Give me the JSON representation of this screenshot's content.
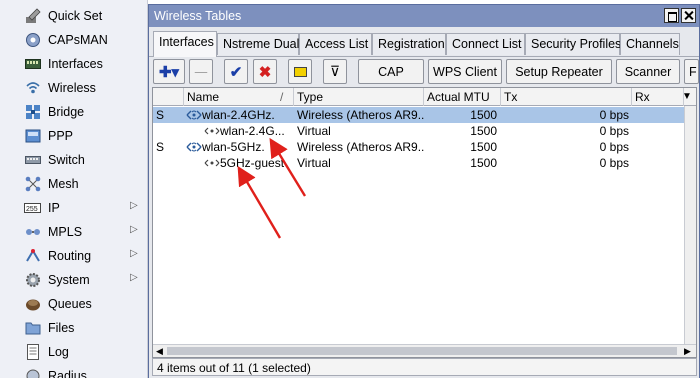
{
  "sidebar": {
    "items": [
      {
        "label": "Quick Set",
        "icon": "quick-set-icon",
        "has_submenu": false
      },
      {
        "label": "CAPsMAN",
        "icon": "capsman-icon",
        "has_submenu": false
      },
      {
        "label": "Interfaces",
        "icon": "interfaces-icon",
        "has_submenu": false
      },
      {
        "label": "Wireless",
        "icon": "wireless-icon",
        "has_submenu": false
      },
      {
        "label": "Bridge",
        "icon": "bridge-icon",
        "has_submenu": false
      },
      {
        "label": "PPP",
        "icon": "ppp-icon",
        "has_submenu": false
      },
      {
        "label": "Switch",
        "icon": "switch-icon",
        "has_submenu": false
      },
      {
        "label": "Mesh",
        "icon": "mesh-icon",
        "has_submenu": false
      },
      {
        "label": "IP",
        "icon": "ip-icon",
        "has_submenu": true
      },
      {
        "label": "MPLS",
        "icon": "mpls-icon",
        "has_submenu": true
      },
      {
        "label": "Routing",
        "icon": "routing-icon",
        "has_submenu": true
      },
      {
        "label": "System",
        "icon": "system-icon",
        "has_submenu": true
      },
      {
        "label": "Queues",
        "icon": "queues-icon",
        "has_submenu": false
      },
      {
        "label": "Files",
        "icon": "files-icon",
        "has_submenu": false
      },
      {
        "label": "Log",
        "icon": "log-icon",
        "has_submenu": false
      },
      {
        "label": "Radius",
        "icon": "radius-icon",
        "has_submenu": false
      }
    ],
    "submenu_arrow": "▷"
  },
  "window": {
    "title": "Wireless Tables",
    "tabs": [
      "Interfaces",
      "Nstreme Dual",
      "Access List",
      "Registration",
      "Connect List",
      "Security Profiles",
      "Channels"
    ],
    "active_tab": "Interfaces"
  },
  "toolbar": {
    "add_glyph": "✚▾",
    "remove_glyph": "—",
    "enable_glyph": "✔",
    "disable_glyph": "✖",
    "comment_glyph": "▭",
    "filter_glyph": "⊽",
    "cap_label": "CAP",
    "wps_label": "WPS Client",
    "repeater_label": "Setup Repeater",
    "scanner_label": "Scanner",
    "overflow_label": "F"
  },
  "table": {
    "columns": [
      "",
      "Name",
      "Type",
      "Actual MTU",
      "Tx",
      "Rx"
    ],
    "sort_indicator": "/",
    "rows": [
      {
        "flag": "S",
        "name": "wlan-2.4GHz.",
        "type": "Wireless (Atheros AR9...",
        "mtu": "1500",
        "tx": "0 bps",
        "rx": "",
        "selected": true,
        "indent": false,
        "icon": "wireless-interface-icon"
      },
      {
        "flag": "",
        "name": "wlan-2.4G...",
        "type": "Virtual",
        "mtu": "1500",
        "tx": "0 bps",
        "rx": "",
        "selected": false,
        "indent": true,
        "icon": "virtual-interface-icon"
      },
      {
        "flag": "S",
        "name": "wlan-5GHz.",
        "type": "Wireless (Atheros AR9...",
        "mtu": "1500",
        "tx": "0 bps",
        "rx": "",
        "selected": false,
        "indent": false,
        "icon": "wireless-interface-icon"
      },
      {
        "flag": "",
        "name": "5GHz-guest",
        "type": "Virtual",
        "mtu": "1500",
        "tx": "0 bps",
        "rx": "",
        "selected": false,
        "indent": true,
        "icon": "virtual-interface-icon"
      }
    ]
  },
  "status": {
    "text": "4 items out of 11 (1 selected)"
  },
  "colors": {
    "window_title_bar": "#7d90be",
    "selected_row": "#a9c5e7",
    "annotation_arrow": "#e0201b",
    "add_icon": "#1b3fa8",
    "enable_icon": "#1b3fa8",
    "disable_icon": "#d42020",
    "comment_icon": "#f2d000"
  }
}
